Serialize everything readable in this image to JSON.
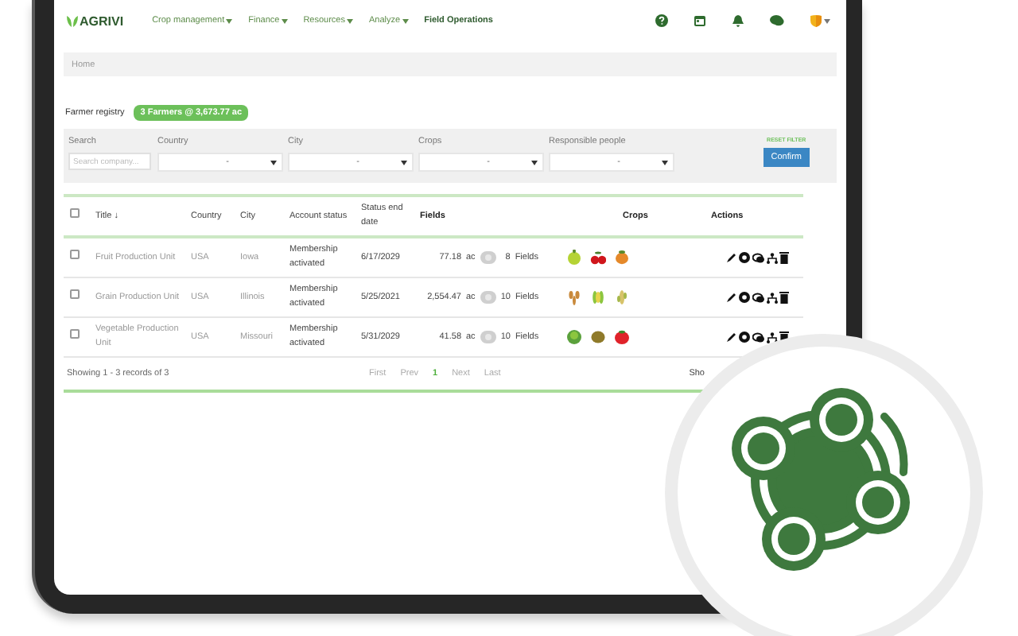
{
  "nav": {
    "logo": "AGRIVI",
    "menu": [
      {
        "label": "Crop management",
        "dropdown": true
      },
      {
        "label": "Finance",
        "dropdown": true
      },
      {
        "label": "Resources",
        "dropdown": true
      },
      {
        "label": "Analyze",
        "dropdown": true
      },
      {
        "label": "Field Operations",
        "dropdown": false
      }
    ]
  },
  "breadcrumb": "Home",
  "registry": {
    "title": "Farmer registry",
    "badge": "3 Farmers @ 3,673.77 ac"
  },
  "filters": {
    "fields": [
      {
        "label": "Search",
        "kind": "text",
        "placeholder": "Search company..."
      },
      {
        "label": "Country",
        "kind": "select",
        "value": "-"
      },
      {
        "label": "City",
        "kind": "select",
        "value": "-"
      },
      {
        "label": "Crops",
        "kind": "select",
        "value": "-"
      },
      {
        "label": "Responsible people",
        "kind": "select",
        "value": "-"
      }
    ],
    "reset": "RESET FILTER",
    "confirm": "Confirm"
  },
  "table": {
    "select_all_checked": false,
    "columns": [
      "Title ↓",
      "Country",
      "City",
      "Account status",
      "Status end date",
      "Fields",
      "Crops",
      "Actions"
    ],
    "rows": [
      {
        "checked": false,
        "title": "Fruit Production Unit",
        "country": "USA",
        "city": "Iowa",
        "account_status": "Membership activated",
        "status_end_date": "6/17/2029",
        "area": "77.18",
        "unit": "ac",
        "field_count": "8",
        "fields_label": "Fields"
      },
      {
        "checked": false,
        "title": "Grain Production Unit",
        "country": "USA",
        "city": "Illinois",
        "account_status": "Membership activated",
        "status_end_date": "5/25/2021",
        "area": "2,554.47",
        "unit": "ac",
        "field_count": "10",
        "fields_label": "Fields"
      },
      {
        "checked": false,
        "title": "Vegetable Production Unit",
        "country": "USA",
        "city": "Missouri",
        "account_status": "Membership activated",
        "status_end_date": "5/31/2029",
        "area": "41.58",
        "unit": "ac",
        "field_count": "10",
        "fields_label": "Fields"
      }
    ]
  },
  "footer": {
    "summary": "Showing 1 - 3 records of 3",
    "pages": [
      {
        "label": "First",
        "selected": false
      },
      {
        "label": "Prev",
        "selected": false
      },
      {
        "label": "1",
        "selected": true
      },
      {
        "label": "Next",
        "selected": false
      },
      {
        "label": "Last",
        "selected": false
      }
    ],
    "page_size_label": "Sho"
  }
}
